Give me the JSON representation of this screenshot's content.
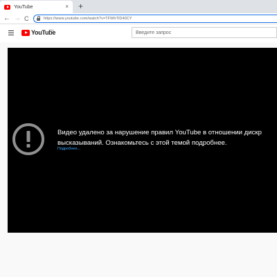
{
  "browser": {
    "tab_title": "YouTube",
    "tab_close": "×",
    "new_tab": "+",
    "back": "←",
    "forward": "→",
    "reload": "C",
    "url": "https://www.youtube.com/watch?v=TFWhTlD40CY"
  },
  "header": {
    "menu_icon": "hamburger-menu-icon",
    "logo_text": "YouTube",
    "region": "RU",
    "search_placeholder": "Введите запрос"
  },
  "player": {
    "icon": "alert-circle-icon",
    "message_line1": "Видео удалено за нарушение правил YouTube в отношении дискр",
    "message_line2": "высказываний. Ознакомьтесь с этой темой подробнее.",
    "learn_more": "Подробнее...",
    "accent": "#3ea6ff"
  }
}
